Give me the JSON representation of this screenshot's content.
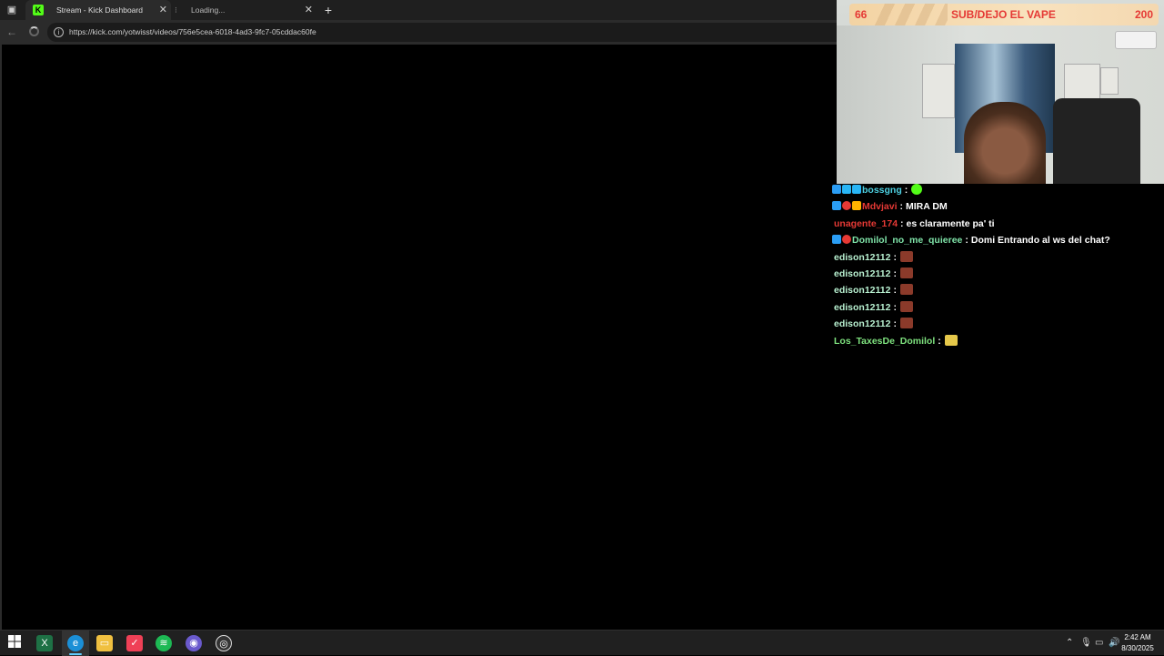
{
  "browser": {
    "tabs": [
      {
        "label": "Stream - Kick Dashboard",
        "favicon": "K"
      },
      {
        "label": "Loading..."
      }
    ],
    "url": "https://kick.com/yotwisst/videos/756e5cea-6018-4ad3-9fc7-05cddac60fe"
  },
  "stream_overlay": {
    "left_count": "66",
    "goal_text": "SUB/DEJO EL VAPE",
    "right_count": "200"
  },
  "chat": {
    "messages": [
      {
        "user": "bossgng",
        "sep": ":",
        "text": "",
        "color": "#4dd0e1",
        "badges": [
          "kick",
          "cyan",
          "cyan"
        ],
        "emote": "green"
      },
      {
        "user": "Mdvjavi",
        "sep": ":",
        "text": "MIRA DM",
        "color": "#e53935",
        "badges": [
          "kick",
          "red",
          "gold"
        ],
        "emote": ""
      },
      {
        "user": "unagente_174",
        "sep": ":",
        "text": "es claramente pa' ti",
        "color": "#e53935",
        "badges": [],
        "emote": ""
      },
      {
        "user": "Domilol_no_me_quieree",
        "sep": ":",
        "text": "Domi Entrando al ws del chat?",
        "color": "#7fe3a8",
        "badges": [
          "kick",
          "red"
        ],
        "emote": ""
      },
      {
        "user": "edison12112",
        "sep": ":",
        "text": "",
        "color": "#b8f0d0",
        "badges": [],
        "emote": "brown"
      },
      {
        "user": "edison12112",
        "sep": ":",
        "text": "",
        "color": "#b8f0d0",
        "badges": [],
        "emote": "brown"
      },
      {
        "user": "edison12112",
        "sep": ":",
        "text": "",
        "color": "#b8f0d0",
        "badges": [],
        "emote": "brown"
      },
      {
        "user": "edison12112",
        "sep": ":",
        "text": "",
        "color": "#b8f0d0",
        "badges": [],
        "emote": "brown"
      },
      {
        "user": "edison12112",
        "sep": ":",
        "text": "",
        "color": "#b8f0d0",
        "badges": [],
        "emote": "brown"
      },
      {
        "user": "Los_TaxesDe_Domilol",
        "sep": ":",
        "text": "",
        "color": "#7fe37f",
        "badges": [],
        "emote": "yellow"
      }
    ]
  },
  "taskbar": {
    "icons": [
      "windows-start-icon",
      "excel-icon",
      "edge-icon",
      "file-explorer-icon",
      "pocket-icon",
      "spotify-icon",
      "chrome-canary-icon",
      "obs-icon"
    ],
    "clock_time": "2:42 AM",
    "clock_date": "8/30/2025"
  },
  "colors": {
    "accent_kick": "#53fc18",
    "overlay_red": "#e53935"
  }
}
